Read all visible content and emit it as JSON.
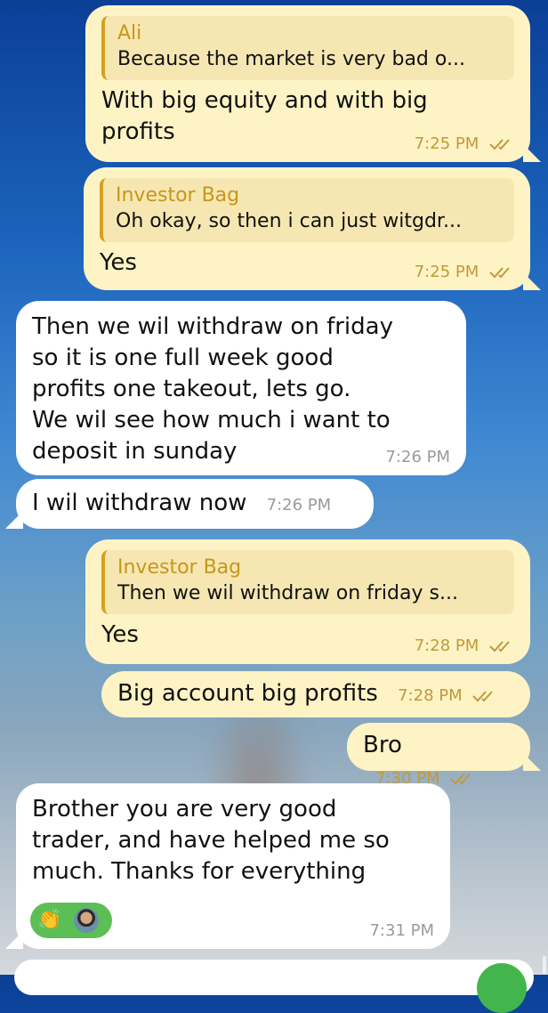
{
  "messages": [
    {
      "reply_name": "Ali",
      "reply_text": "Because the market is very bad o...",
      "text": "With big equity and with big\nprofits",
      "time": "7:25 PM"
    },
    {
      "reply_name": "Investor Bag",
      "reply_text": "Oh okay, so then i can just witgdr...",
      "text": "Yes",
      "time": "7:25 PM"
    },
    {
      "text": "Then we wil withdraw on friday\nso it is one full week good\nprofits one takeout, lets go.\nWe wil see how much i want to\ndeposit in sunday",
      "time": "7:26 PM"
    },
    {
      "text": "I wil withdraw now",
      "time": "7:26 PM"
    },
    {
      "reply_name": "Investor Bag",
      "reply_text": "Then we wil withdraw on friday s...",
      "text": "Yes",
      "time": "7:28 PM"
    },
    {
      "text": "Big account big profits",
      "time": "7:28 PM"
    },
    {
      "text": "Bro",
      "time": "7:30 PM"
    },
    {
      "text": "Brother you are very good\ntrader, and have helped me so\nmuch. Thanks for everything",
      "time": "7:31 PM",
      "reaction_emoji": "👏"
    }
  ],
  "colors": {
    "outgoing": "#fdf3c4",
    "incoming": "#ffffff",
    "reply_name": "#c8961a",
    "reaction": "#5cbf56"
  },
  "icons": {
    "read_receipt": "double-check-icon",
    "reaction": "clapping-hands-emoji"
  }
}
